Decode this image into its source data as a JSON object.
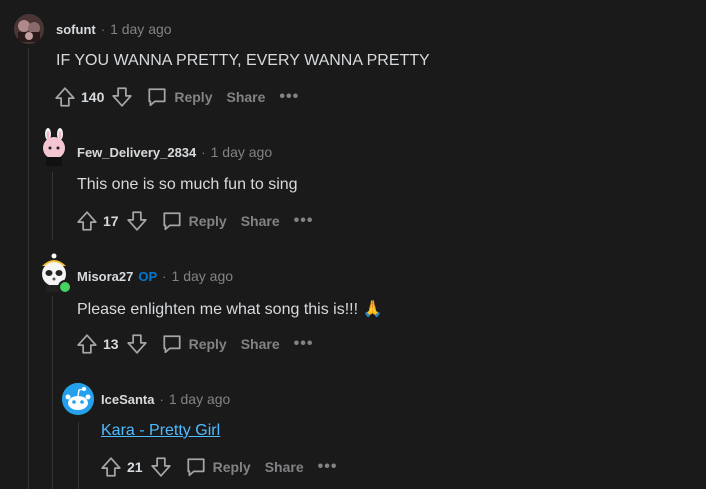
{
  "comments": [
    {
      "author": "sofunt",
      "op": "",
      "time": "1 day ago",
      "body": "IF YOU WANNA PRETTY, EVERY WANNA PRETTY",
      "score": "140",
      "reply": "Reply",
      "share": "Share",
      "more": "•••"
    },
    {
      "author": "Few_Delivery_2834",
      "op": "",
      "time": "1 day ago",
      "body": "This one is so much fun to sing",
      "score": "17",
      "reply": "Reply",
      "share": "Share",
      "more": "•••"
    },
    {
      "author": "Misora27",
      "op": "OP",
      "time": "1 day ago",
      "body": "Please enlighten me what song this is!!! 🙏",
      "score": "13",
      "reply": "Reply",
      "share": "Share",
      "more": "•••"
    },
    {
      "author": "IceSanta",
      "op": "",
      "time": "1 day ago",
      "body": "Kara - Pretty Girl",
      "score": "21",
      "reply": "Reply",
      "share": "Share",
      "more": "•••"
    }
  ],
  "separator": "·",
  "colors": {
    "background": "#1a1a1b",
    "text": "#d7dadc",
    "muted": "#818384",
    "op": "#0079d3",
    "link": "#4fbcff",
    "online": "#46d160"
  },
  "icons": [
    "upvote-icon",
    "downvote-icon",
    "comment-bubble-icon",
    "more-icon"
  ]
}
